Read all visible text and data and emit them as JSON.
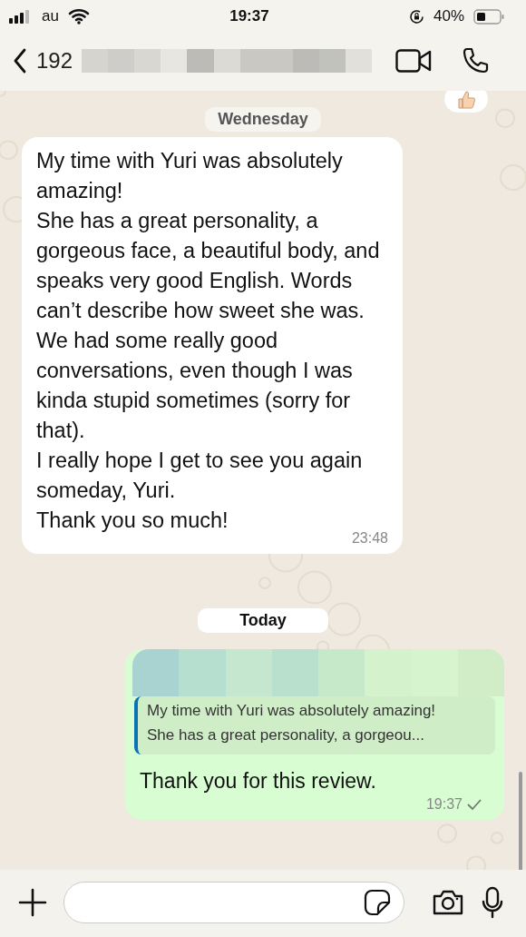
{
  "status_bar": {
    "carrier": "au",
    "time": "19:37",
    "battery": "40%"
  },
  "header": {
    "title": "192"
  },
  "messages": [
    {
      "kind": "reaction"
    },
    {
      "kind": "date",
      "text": "Wednesday"
    },
    {
      "kind": "incoming",
      "text": "My time with Yuri was absolutely amazing!\nShe has a great personality, a gorgeous face, a beautiful body, and speaks very good English. Words can’t describe how sweet she was. We had some really good conversations, even though I was kinda stupid sometimes (sorry for that).\nI really hope I get to see you again someday, Yuri.\nThank you so much!",
      "time": "23:48"
    },
    {
      "kind": "date",
      "text": "Today"
    },
    {
      "kind": "outgoing",
      "quote": "My time with Yuri was absolutely amazing!\nShe has a great personality, a gorgeou...",
      "text": "Thank you for this review.",
      "time": "19:37",
      "delivered": true
    }
  ]
}
